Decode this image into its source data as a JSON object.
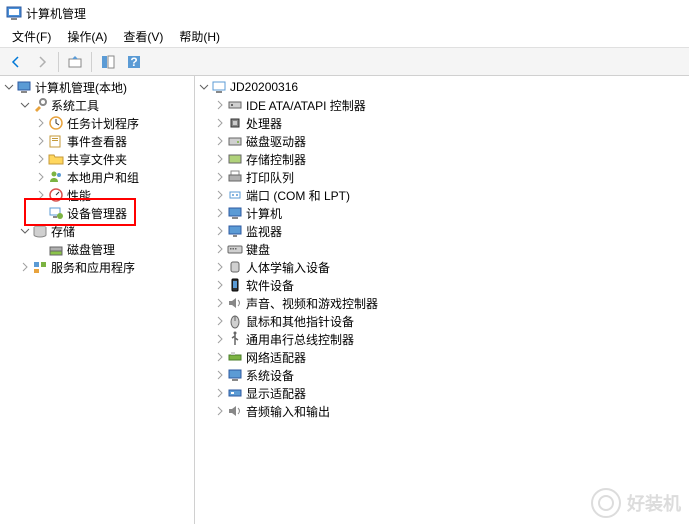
{
  "window": {
    "title": "计算机管理"
  },
  "menu": {
    "file": "文件(F)",
    "action": "操作(A)",
    "view": "查看(V)",
    "help": "帮助(H)"
  },
  "left_tree": {
    "root": "计算机管理(本地)",
    "system_tools": "系统工具",
    "task_scheduler": "任务计划程序",
    "event_viewer": "事件查看器",
    "shared_folders": "共享文件夹",
    "local_users": "本地用户和组",
    "performance": "性能",
    "device_manager": "设备管理器",
    "storage": "存储",
    "disk_management": "磁盘管理",
    "services_apps": "服务和应用程序"
  },
  "right_tree": {
    "computer_name": "JD20200316",
    "ide_ata": "IDE ATA/ATAPI 控制器",
    "processors": "处理器",
    "disk_drives": "磁盘驱动器",
    "storage_controllers": "存储控制器",
    "print_queues": "打印队列",
    "ports": "端口 (COM 和 LPT)",
    "computer": "计算机",
    "monitors": "监视器",
    "keyboards": "键盘",
    "hid": "人体学输入设备",
    "software_devices": "软件设备",
    "sound_video": "声音、视频和游戏控制器",
    "mice": "鼠标和其他指针设备",
    "usb": "通用串行总线控制器",
    "network_adapters": "网络适配器",
    "system_devices": "系统设备",
    "display_adapters": "显示适配器",
    "audio_inputs": "音频输入和输出"
  },
  "watermark": "好装机"
}
